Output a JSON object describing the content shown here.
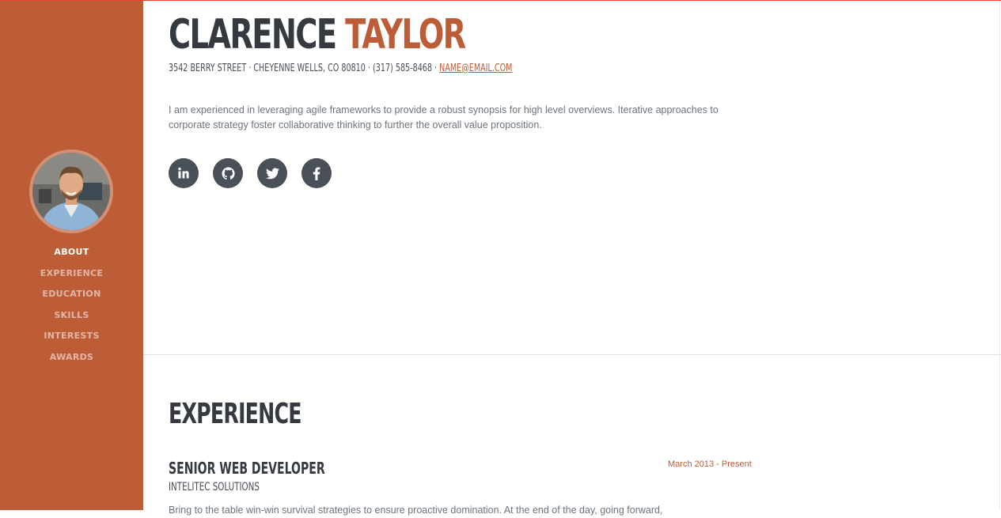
{
  "colors": {
    "accent": "#bd5d38",
    "dark": "#343a40",
    "icon_bg": "#495057",
    "muted_text": "#6c757d"
  },
  "sidebar": {
    "avatar_alt": "profile photo",
    "nav": [
      {
        "label": "ABOUT",
        "active": true
      },
      {
        "label": "EXPERIENCE",
        "active": false
      },
      {
        "label": "EDUCATION",
        "active": false
      },
      {
        "label": "SKILLS",
        "active": false
      },
      {
        "label": "INTERESTS",
        "active": false
      },
      {
        "label": "AWARDS",
        "active": false
      }
    ]
  },
  "about": {
    "first_name": "CLARENCE",
    "last_name": "TAYLOR",
    "address": "3542 BERRY STREET · CHEYENNE WELLS, CO 80810 · (317) 585-8468 ·",
    "email": "NAME@EMAIL.COM",
    "bio": "I am experienced in leveraging agile frameworks to provide a robust synopsis for high level overviews. Iterative approaches to corporate strategy foster collaborative thinking to further the overall value proposition.",
    "social": [
      {
        "name": "linkedin-icon",
        "glyph": "in"
      },
      {
        "name": "github-icon",
        "glyph": "github"
      },
      {
        "name": "twitter-icon",
        "glyph": "twitter"
      },
      {
        "name": "facebook-icon",
        "glyph": "f"
      }
    ]
  },
  "experience": {
    "title": "EXPERIENCE",
    "jobs": [
      {
        "title": "SENIOR WEB DEVELOPER",
        "company": "INTELITEC SOLUTIONS",
        "date": "March 2013 - Present",
        "description": "Bring to the table win-win survival strategies to ensure proactive domination. At the end of the day, going forward,"
      }
    ]
  }
}
